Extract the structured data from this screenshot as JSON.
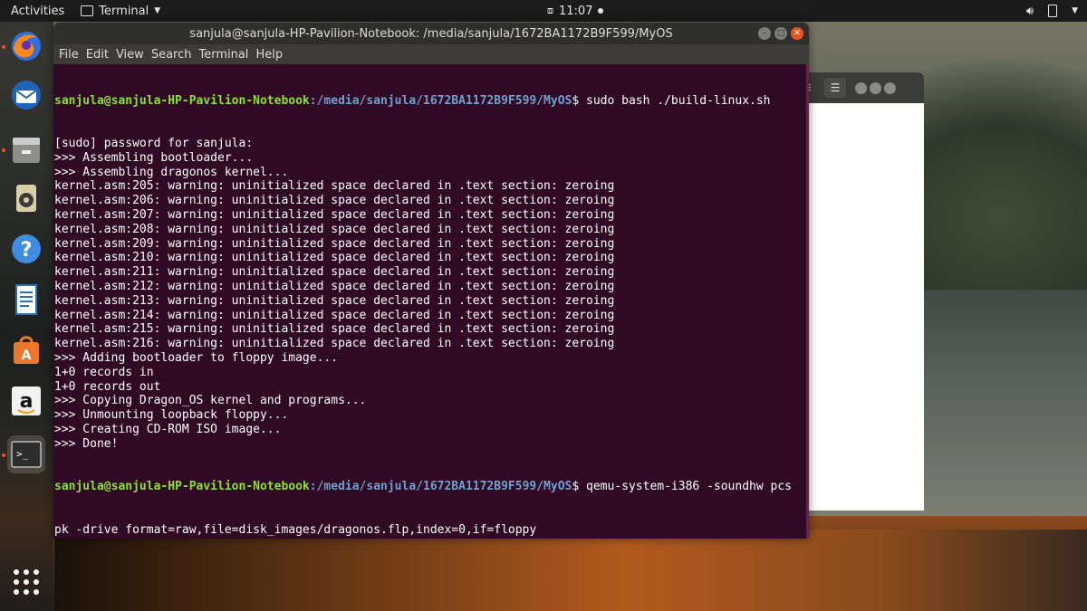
{
  "topbar": {
    "activities": "Activities",
    "app_name": "Terminal",
    "clock": "11:07"
  },
  "dock": {
    "items": [
      "firefox-icon",
      "thunderbird-icon",
      "files-icon",
      "rhythmbox-icon",
      "help-icon",
      "libreoffice-writer-icon",
      "software-icon",
      "amazon-icon",
      "terminal-icon",
      "show-apps-icon"
    ]
  },
  "terminal": {
    "title": "sanjula@sanjula-HP-Pavilion-Notebook: /media/sanjula/1672BA1172B9F599/MyOS",
    "menu": [
      "File",
      "Edit",
      "View",
      "Search",
      "Terminal",
      "Help"
    ],
    "prompt_user": "sanjula@sanjula-HP-Pavilion-Notebook",
    "prompt_path": ":/media/sanjula/1672BA1172B9F599/MyOS",
    "prompt_symbol": "$ ",
    "cmd1": "sudo bash ./build-linux.sh",
    "output": [
      "[sudo] password for sanjula:",
      ">>> Assembling bootloader...",
      ">>> Assembling dragonos kernel...",
      "kernel.asm:205: warning: uninitialized space declared in .text section: zeroing",
      "kernel.asm:206: warning: uninitialized space declared in .text section: zeroing",
      "kernel.asm:207: warning: uninitialized space declared in .text section: zeroing",
      "kernel.asm:208: warning: uninitialized space declared in .text section: zeroing",
      "kernel.asm:209: warning: uninitialized space declared in .text section: zeroing",
      "kernel.asm:210: warning: uninitialized space declared in .text section: zeroing",
      "kernel.asm:211: warning: uninitialized space declared in .text section: zeroing",
      "kernel.asm:212: warning: uninitialized space declared in .text section: zeroing",
      "kernel.asm:213: warning: uninitialized space declared in .text section: zeroing",
      "kernel.asm:214: warning: uninitialized space declared in .text section: zeroing",
      "kernel.asm:215: warning: uninitialized space declared in .text section: zeroing",
      "kernel.asm:216: warning: uninitialized space declared in .text section: zeroing",
      ">>> Adding bootloader to floppy image...",
      "1+0 records in",
      "1+0 records out",
      ">>> Copying Dragon_OS kernel and programs...",
      ">>> Unmounting loopback floppy...",
      ">>> Creating CD-ROM ISO image...",
      ">>> Done!"
    ],
    "cmd2": "qemu-system-i386 -soundhw pcs",
    "cmd2_wrap": "pk -drive format=raw,file=disk_images/dragonos.flp,index=0,if=floppy"
  },
  "colors": {
    "terminal_bg": "#300a24",
    "prompt_user": "#8ae234",
    "prompt_path": "#729fcf",
    "accent": "#e95420"
  }
}
